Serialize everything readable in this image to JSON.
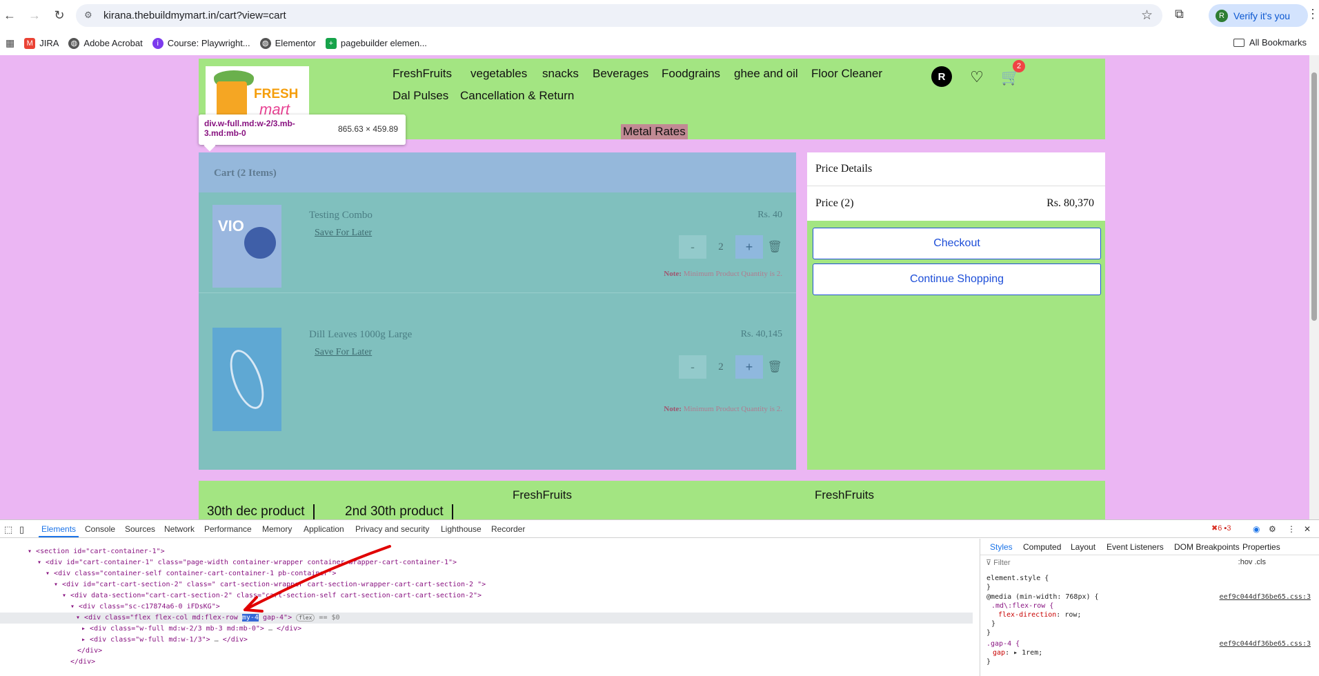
{
  "browser": {
    "url": "kirana.thebuildmymart.in/cart?view=cart",
    "profile_label": "Verify it's you",
    "profile_initial": "R",
    "bookmarks": [
      "JIRA",
      "Adobe Acrobat",
      "Course: Playwright...",
      "Elementor",
      "pagebuilder elemen..."
    ],
    "all_bookmarks": "All Bookmarks"
  },
  "site": {
    "logo": {
      "line1": "FRESH",
      "line2": "mart"
    },
    "nav": [
      "FreshFruits",
      "vegetables",
      "snacks",
      "Beverages",
      "Foodgrains",
      "ghee and oil",
      "Floor Cleaner",
      "Dal Pulses",
      "Cancellation & Return"
    ],
    "metal_rates": "Metal Rates",
    "user_initial": "R",
    "cart_count": "2"
  },
  "inspector_tooltip": {
    "selector": "div.w-full.md:w-2/3.mb-3.md:mb-0",
    "dims": "865.63 × 459.89"
  },
  "cart": {
    "title": "Cart (2 Items)",
    "items": [
      {
        "name": "Testing Combo",
        "price": "Rs. 40",
        "save": "Save For Later",
        "qty": "2",
        "note_label": "Note:",
        "note": "Minimum Product Quantity is 2.",
        "thumb_text": "VIO"
      },
      {
        "name": "Dill Leaves 1000g Large",
        "price": "Rs. 40,145",
        "save": "Save For Later",
        "qty": "2",
        "note_label": "Note:",
        "note": "Minimum Product Quantity is 2."
      }
    ],
    "minus": "-",
    "plus": "+"
  },
  "price_details": {
    "title": "Price Details",
    "label": "Price (2)",
    "value": "Rs. 80,370",
    "checkout": "Checkout",
    "continue": "Continue Shopping"
  },
  "footer": {
    "links": [
      "FreshFruits",
      "FreshFruits"
    ],
    "products": [
      "30th dec product",
      "2nd 30th product"
    ]
  },
  "devtools": {
    "tabs": [
      "Elements",
      "Console",
      "Sources",
      "Network",
      "Performance",
      "Memory",
      "Application",
      "Privacy and security",
      "Lighthouse",
      "Recorder"
    ],
    "errors": "6",
    "warnings": "3",
    "style_tabs": [
      "Styles",
      "Computed",
      "Layout",
      "Event Listeners",
      "DOM Breakpoints",
      "Properties"
    ],
    "filter_placeholder": "Filter",
    "filter_tools": ":hov .cls",
    "dom": [
      "<section id=\"cart-container-1\">",
      "<div id=\"cart-container-1\" class=\"page-width container-wrapper container-wrapper-cart-container-1\">",
      "<div class=\"container-self container-cart-container-1 pb-container\">",
      "<div id=\"cart-cart-section-2\" class=\" cart-section-wrapper cart-section-wrapper-cart-cart-section-2 \">",
      "<div data-section=\"cart-cart-section-2\" class=\"cart-section-self cart-section-cart-cart-section-2\">",
      "<div class=\"sc-c17874a6-0 iFDsKG\">",
      "<div class=\"flex flex-col md:flex-row ",
      "my-4",
      " gap-4\">",
      "flex",
      "== $0",
      "<div class=\"w-full md:w-2/3 mb-3 md:mb-0\">",
      "</div>",
      "<div class=\"w-full md:w-1/3\">",
      "</div>",
      "</div>",
      "</div>"
    ],
    "styles": [
      "element.style {",
      "}",
      "@media (min-width: 768px) {",
      ".md\\:flex-row {",
      "flex-direction",
      ": row;",
      "}",
      "}",
      ".gap-4 {",
      "gap",
      ": ▸ 1rem;",
      "}"
    ],
    "style_src": "eef9c044df36be65.css:3"
  }
}
